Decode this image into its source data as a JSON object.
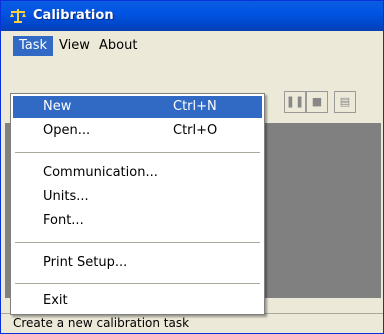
{
  "window": {
    "title": "Calibration"
  },
  "menubar": {
    "items": [
      "Task",
      "View",
      "About"
    ]
  },
  "dropdown": {
    "items": [
      {
        "label": "New",
        "shortcut": "Ctrl+N"
      },
      {
        "label": "Open...",
        "shortcut": "Ctrl+O"
      },
      {
        "label": "Communication...",
        "shortcut": ""
      },
      {
        "label": "Units...",
        "shortcut": ""
      },
      {
        "label": "Font...",
        "shortcut": ""
      },
      {
        "label": "Print Setup...",
        "shortcut": ""
      },
      {
        "label": "Exit",
        "shortcut": ""
      }
    ]
  },
  "status": {
    "text": "Create a new calibration task"
  },
  "colors": {
    "titlebar": "#0054e3",
    "highlight": "#316ac5",
    "content": "#808080"
  },
  "icons": {
    "app": "scale-icon"
  }
}
